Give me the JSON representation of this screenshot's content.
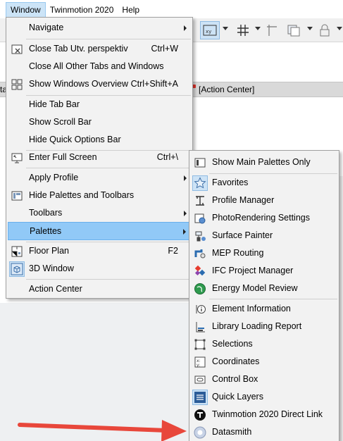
{
  "menubar": {
    "items": [
      {
        "label": "Window",
        "active": true
      },
      {
        "label": "Twinmotion 2020",
        "active": false
      },
      {
        "label": "Help",
        "active": false
      }
    ]
  },
  "tab": {
    "label": "[Action Center]",
    "left_partial": "ta"
  },
  "window_menu": {
    "items": [
      {
        "id": "navigate",
        "label": "Navigate",
        "submenu": true
      },
      {
        "id": "close-tab",
        "label": "Close Tab Utv. perspektiv",
        "shortcut": "Ctrl+W",
        "icon": "close-tab-icon"
      },
      {
        "id": "close-all-other",
        "label": "Close All Other Tabs and Windows"
      },
      {
        "id": "show-windows-overview",
        "label": "Show Windows Overview",
        "shortcut": "Ctrl+Shift+A",
        "icon": "windows-overview-icon"
      },
      {
        "id": "hide-tab-bar",
        "label": "Hide Tab Bar"
      },
      {
        "id": "show-scroll-bar",
        "label": "Show Scroll Bar"
      },
      {
        "id": "hide-quick-options-bar",
        "label": "Hide Quick Options Bar"
      },
      {
        "id": "enter-full-screen",
        "label": "Enter Full Screen",
        "shortcut": "Ctrl+\\",
        "icon": "full-screen-icon"
      },
      {
        "id": "apply-profile",
        "label": "Apply Profile",
        "submenu": true
      },
      {
        "id": "hide-palettes-toolbars",
        "label": "Hide Palettes and Toolbars",
        "icon": "palettes-toolbars-icon"
      },
      {
        "id": "toolbars",
        "label": "Toolbars",
        "submenu": true
      },
      {
        "id": "palettes",
        "label": "Palettes",
        "submenu": true,
        "highlighted": true
      },
      {
        "id": "floor-plan",
        "label": "Floor Plan",
        "shortcut": "F2",
        "icon": "floor-plan-icon"
      },
      {
        "id": "3d-window",
        "label": "3D Window",
        "icon": "3d-window-icon"
      },
      {
        "id": "action-center",
        "label": "Action Center"
      }
    ]
  },
  "palettes_menu": {
    "items": [
      {
        "id": "show-main-palettes",
        "label": "Show Main Palettes Only",
        "icon": "main-palettes-icon"
      },
      {
        "id": "favorites",
        "label": "Favorites",
        "icon": "star-icon"
      },
      {
        "id": "profile-manager",
        "label": "Profile Manager",
        "icon": "profile-manager-icon"
      },
      {
        "id": "photorendering",
        "label": "PhotoRendering Settings",
        "icon": "photorendering-icon"
      },
      {
        "id": "surface-painter",
        "label": "Surface Painter",
        "icon": "surface-painter-icon"
      },
      {
        "id": "mep-routing",
        "label": "MEP Routing",
        "icon": "mep-routing-icon"
      },
      {
        "id": "ifc-project-manager",
        "label": "IFC Project Manager",
        "icon": "ifc-icon"
      },
      {
        "id": "energy-model-review",
        "label": "Energy Model Review",
        "icon": "energy-globe-icon"
      },
      {
        "id": "element-information",
        "label": "Element Information",
        "icon": "element-info-icon"
      },
      {
        "id": "library-loading-report",
        "label": "Library Loading Report",
        "icon": "library-report-icon"
      },
      {
        "id": "selections",
        "label": "Selections",
        "icon": "selections-icon"
      },
      {
        "id": "coordinates",
        "label": "Coordinates",
        "icon": "coordinates-icon"
      },
      {
        "id": "control-box",
        "label": "Control Box",
        "icon": "control-box-icon"
      },
      {
        "id": "quick-layers",
        "label": "Quick Layers",
        "icon": "quick-layers-icon"
      },
      {
        "id": "twinmotion-direct-link",
        "label": "Twinmotion 2020 Direct Link",
        "icon": "twinmotion-icon"
      },
      {
        "id": "datasmith",
        "label": "Datasmith",
        "icon": "datasmith-icon"
      }
    ]
  },
  "colors": {
    "menu_bg": "#f2f2f2",
    "highlight": "#91c9f7",
    "annotation_arrow": "#e8473b"
  }
}
